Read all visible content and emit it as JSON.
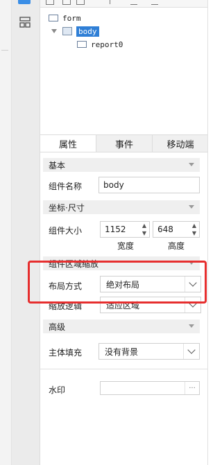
{
  "tree": {
    "form": "form",
    "body": "body",
    "report": "report0"
  },
  "tabs": [
    "属性",
    "事件",
    "移动端"
  ],
  "sections": {
    "basic": "基本",
    "coords": "坐标·尺寸",
    "scale": "组件区域缩放",
    "advanced": "高级"
  },
  "fields": {
    "component_name_label": "组件名称",
    "component_name_value": "body",
    "component_size_label": "组件大小",
    "width_value": "1152",
    "height_value": "648",
    "width_caption": "宽度",
    "height_caption": "高度",
    "layout_label": "布局方式",
    "layout_value": "绝对布局",
    "scale_label": "缩放逻辑",
    "scale_value": "适应区域",
    "fill_label": "主体填充",
    "fill_value": "没有背景",
    "watermark_label": "水印",
    "watermark_value": "",
    "watermark_button": "···"
  },
  "colors": {
    "selection": "#2f7fd6",
    "highlight_box": "#e62e2e"
  }
}
